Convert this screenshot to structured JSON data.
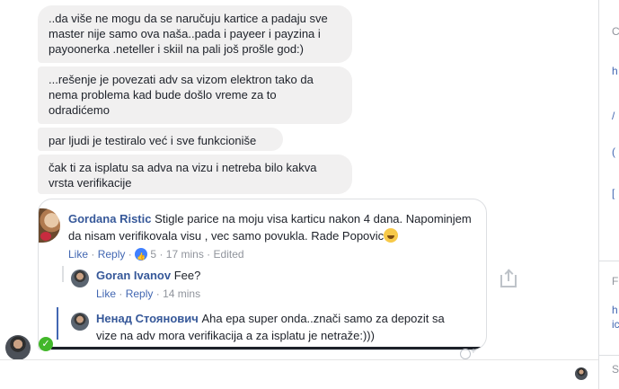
{
  "messages": [
    {
      "lines": [
        "..da više ne mogu da se naručuju kartice a padaju sve",
        "master nije samo ova naša..pada i payeer i payzina i",
        "payoonerka .neteller i skiil na pali još prošle god:)"
      ]
    },
    {
      "lines": [
        "...rešenje je povezati adv sa vizom elektron tako da",
        "nema problema kad bude došlo vreme za to",
        "odradićemo"
      ]
    },
    {
      "lines": [
        "par ljudi je testiralo već i sve funkcioniše"
      ]
    },
    {
      "lines": [
        "čak ti za isplatu sa adva na vizu i netreba bilo kakva",
        "vrsta verifikacije"
      ]
    }
  ],
  "shared_comment": {
    "author": "Gordana Ristic",
    "text_line1": "Stigle parice na moju visa karticu nakon 4 dana. Napominjem",
    "text_line2": "da nisam verifikovala visu , vec samo povukla. Rade Popovic",
    "like_label": "Like",
    "reply_label": "Reply",
    "like_count": "5",
    "time": "17 mins",
    "edited_label": "Edited",
    "separator": "·"
  },
  "replies": [
    {
      "author": "Goran Ivanov",
      "text": "Fee?",
      "like_label": "Like",
      "reply_label": "Reply",
      "time": "14 mins"
    },
    {
      "author": "Ненад Стоянович",
      "text_line1": "Aha epa super onda..znači samo za depozit sa",
      "text_line2": "vize na adv mora verifikacija a za isplatu je netraže:)))"
    }
  ],
  "right_panel": {
    "items": [
      "C",
      "h",
      "/",
      "(",
      "[",
      "F",
      "h",
      "ic",
      "S"
    ]
  },
  "colors": {
    "bubble": "#f1f0f0",
    "link": "#365899",
    "action": "#4267b2",
    "muted": "#90949c",
    "online": "#42b72a"
  },
  "icons": [
    "share-icon",
    "add-reaction-icon",
    "online-check-icon",
    "like-reaction-icon",
    "smile-emoji-icon"
  ]
}
